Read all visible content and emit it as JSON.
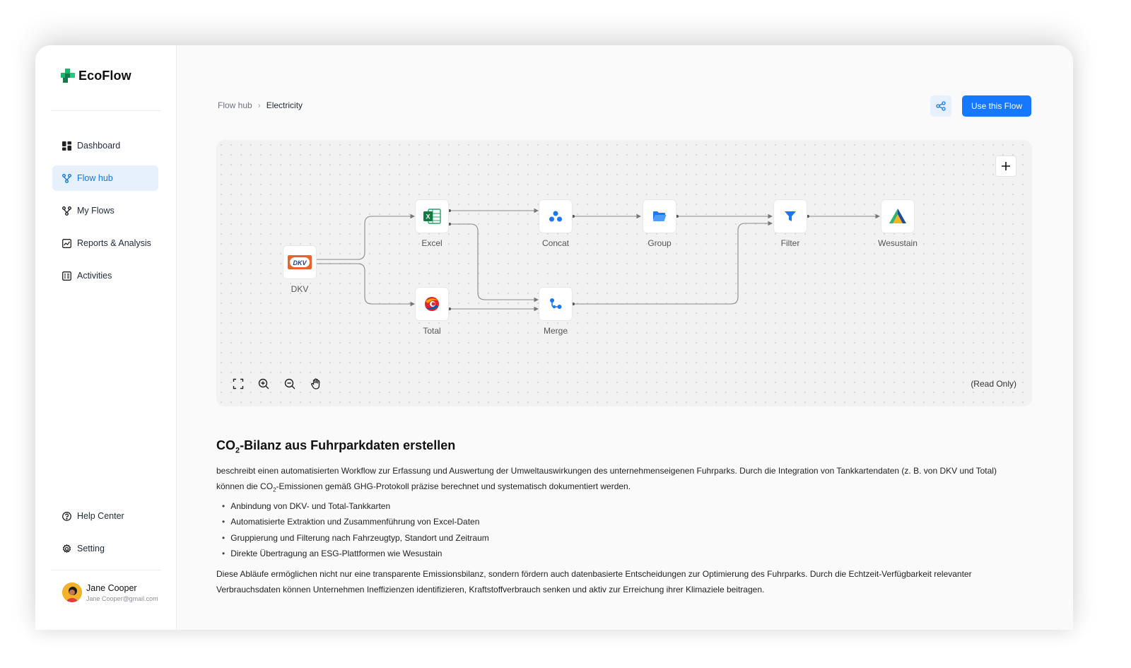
{
  "app": {
    "name": "EcoFlow"
  },
  "sidebar": {
    "items": [
      {
        "label": "Dashboard",
        "icon": "dashboard-icon",
        "active": false
      },
      {
        "label": "Flow hub",
        "icon": "flow-hub-icon",
        "active": true
      },
      {
        "label": "My Flows",
        "icon": "my-flows-icon",
        "active": false
      },
      {
        "label": "Reports & Analysis",
        "icon": "reports-icon",
        "active": false
      },
      {
        "label": "Activities",
        "icon": "activities-icon",
        "active": false
      }
    ],
    "bottom_items": [
      {
        "label": "Help Center",
        "icon": "help-icon"
      },
      {
        "label": "Setting",
        "icon": "gear-icon"
      }
    ],
    "user": {
      "name": "Jane Cooper",
      "email": "Jane Cooper@gmail.com"
    }
  },
  "header": {
    "breadcrumb": [
      "Flow hub",
      "Electricity"
    ],
    "share_icon": "share-icon",
    "primary_button": "Use this Flow"
  },
  "canvas": {
    "nodes": [
      {
        "id": "dkv",
        "label": "DKV",
        "icon": "dkv-logo-icon"
      },
      {
        "id": "excel",
        "label": "Excel",
        "icon": "excel-icon"
      },
      {
        "id": "total",
        "label": "Total",
        "icon": "total-logo-icon"
      },
      {
        "id": "concat",
        "label": "Concat",
        "icon": "concat-icon"
      },
      {
        "id": "merge",
        "label": "Merge",
        "icon": "merge-icon"
      },
      {
        "id": "group",
        "label": "Group",
        "icon": "folder-icon"
      },
      {
        "id": "filter",
        "label": "Filter",
        "icon": "filter-icon"
      },
      {
        "id": "wesustain",
        "label": "Wesustain",
        "icon": "wesustain-logo-icon"
      }
    ],
    "edges": [
      [
        "dkv",
        "excel"
      ],
      [
        "dkv",
        "total"
      ],
      [
        "excel",
        "concat"
      ],
      [
        "excel",
        "merge"
      ],
      [
        "total",
        "merge"
      ],
      [
        "concat",
        "group"
      ],
      [
        "group",
        "filter"
      ],
      [
        "merge",
        "filter"
      ],
      [
        "filter",
        "wesustain"
      ]
    ],
    "tools": [
      "fullscreen-icon",
      "zoom-in-icon",
      "zoom-out-icon",
      "hand-pan-icon"
    ],
    "mode_label": "(Read Only)"
  },
  "description": {
    "title_prefix": "CO",
    "title_sub": "2",
    "title_suffix": "-Bilanz aus Fuhrparkdaten erstellen",
    "intro_line1": "beschreibt einen automatisierten Workflow zur Erfassung und Auswertung der Umweltauswirkungen des unternehmenseigenen Fuhrparks. Durch die Integration von Tankkartendaten (z. B. von DKV und Total)",
    "intro_line2_prefix": "können die CO",
    "intro_line2_sub": "2",
    "intro_line2_suffix": "-Emissionen gemäß GHG-Protokoll präzise berechnet und systematisch dokumentiert werden.",
    "bullets": [
      "Anbindung von DKV- und Total-Tankkarten",
      "Automatisierte Extraktion und Zusammenführung von Excel-Daten",
      "Gruppierung und Filterung nach Fahrzeugtyp, Standort und Zeitraum",
      "Direkte Übertragung an ESG-Plattformen wie Wesustain"
    ],
    "outro_line1": "Diese Abläufe ermöglichen nicht nur eine transparente Emissionsbilanz, sondern fördern auch datenbasierte Entscheidungen zur Optimierung des Fuhrparks. Durch die Echtzeit-Verfügbarkeit relevanter",
    "outro_line2": "Verbrauchsdaten können Unternehmen Ineffizienzen identifizieren, Kraftstoffverbrauch senken und aktiv zur Erreichung ihrer Klimaziele beitragen."
  }
}
